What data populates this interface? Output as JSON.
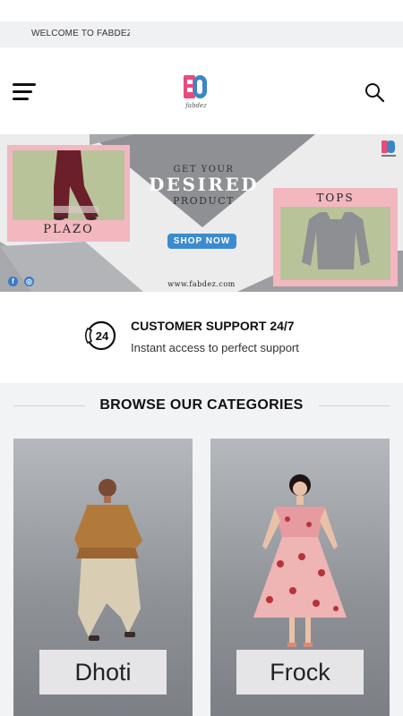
{
  "topbar": {
    "welcome_text": "WELCOME TO FABDEZ"
  },
  "header": {
    "logo_text": "fabdez"
  },
  "banner": {
    "plazo_label": "PLAZO",
    "tops_label": "TOPS",
    "get_your": "GET YOUR",
    "desired": "DESIRED",
    "product": "PRODUCT",
    "shop_now": "SHOP NOW",
    "website": "www.fabdez.com",
    "facebook_glyph": "f",
    "instagram_glyph": "◎"
  },
  "support": {
    "badge": "24",
    "title": "CUSTOMER SUPPORT 24/7",
    "subtitle": "Instant access to perfect support"
  },
  "categories": {
    "heading": "BROWSE OUR CATEGORIES",
    "items": [
      {
        "label": "Dhoti"
      },
      {
        "label": "Frock"
      }
    ]
  },
  "colors": {
    "accent_blue": "#3b8bd0",
    "banner_pink": "#f3b7c0",
    "banner_grey": "#a6a8ab"
  }
}
